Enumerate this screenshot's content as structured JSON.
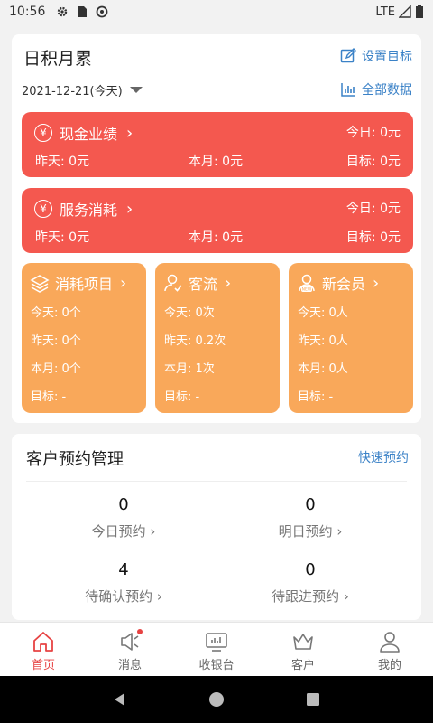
{
  "status_bar": {
    "time": "10:56",
    "network": "LTE"
  },
  "summary": {
    "title": "日积月累",
    "set_goal": "设置目标",
    "date": "2021-12-21(今天)",
    "all_data": "全部数据",
    "cash": {
      "title": "现金业绩",
      "today": "今日: 0元",
      "yesterday": "昨天: 0元",
      "month": "本月: 0元",
      "target": "目标: 0元"
    },
    "service": {
      "title": "服务消耗",
      "today": "今日: 0元",
      "yesterday": "昨天: 0元",
      "month": "本月: 0元",
      "target": "目标: 0元"
    },
    "items": {
      "title": "消耗项目",
      "today": "今天: 0个",
      "yesterday": "昨天: 0个",
      "month": "本月: 0个",
      "target": "目标: -"
    },
    "traffic": {
      "title": "客流",
      "today": "今天: 0次",
      "yesterday": "昨天: 0.2次",
      "month": "本月: 1次",
      "target": "目标: -"
    },
    "members": {
      "title": "新会员",
      "today": "今天: 0人",
      "yesterday": "昨天: 0人",
      "month": "本月: 0人",
      "target": "目标: -"
    }
  },
  "appointments": {
    "title": "客户预约管理",
    "quick": "快速预约",
    "today": {
      "count": "0",
      "label": "今日预约 ›"
    },
    "tomorrow": {
      "count": "0",
      "label": "明日预约 ›"
    },
    "pending": {
      "count": "4",
      "label": "待确认预约 ›"
    },
    "followup": {
      "count": "0",
      "label": "待跟进预约 ›"
    }
  },
  "tabs": [
    "首页",
    "消息",
    "收银台",
    "客户",
    "我的"
  ],
  "colors": {
    "red": "#f4584f",
    "orange": "#f9a85a",
    "link": "#3b82c7",
    "active": "#e74343"
  }
}
